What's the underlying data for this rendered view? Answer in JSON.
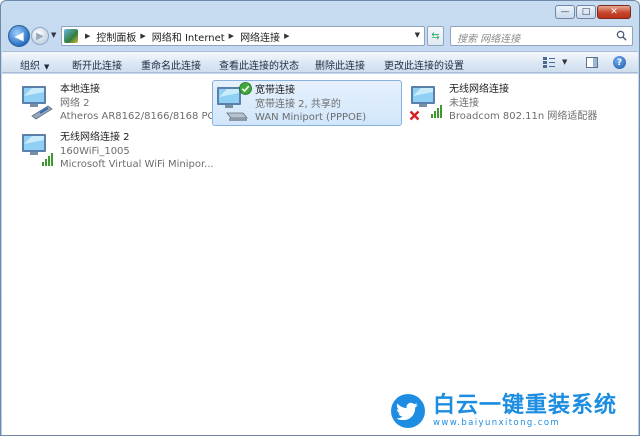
{
  "window": {
    "minimize_glyph": "—",
    "maximize_glyph": "□",
    "close_glyph": "✕"
  },
  "address": {
    "breadcrumbs": [
      "控制面板",
      "网络和 Internet",
      "网络连接"
    ],
    "search_placeholder": "搜索 网络连接"
  },
  "toolbar": {
    "organize": "组织",
    "disconnect": "断开此连接",
    "rename": "重命名此连接",
    "view_status": "查看此连接的状态",
    "delete": "删除此连接",
    "change_settings": "更改此连接的设置",
    "help_glyph": "?"
  },
  "connections": [
    {
      "name": "本地连接",
      "status": "网络  2",
      "device": "Atheros AR8162/8166/8168 PC...",
      "icon": "ethernet-icon"
    },
    {
      "name": "宽带连接",
      "status": "宽带连接  2, 共享的",
      "device": "WAN Miniport (PPPOE)",
      "icon": "broadband-icon",
      "badge": "connected-check",
      "selected": true
    },
    {
      "name": "无线网络连接",
      "status": "未连接",
      "device": "Broadcom 802.11n 网络适配器",
      "icon": "wireless-icon",
      "badge": "disconnected-x"
    },
    {
      "name": "无线网络连接 2",
      "status": "160WiFi_1005",
      "device": "Microsoft Virtual WiFi Minipor...",
      "icon": "wireless-icon"
    }
  ],
  "watermark": {
    "brand": "白云一键重装系统",
    "url": "www.baiyunxitong.com"
  },
  "colors": {
    "accent": "#1c8de0",
    "selection": "#d1e6fb",
    "toolbar": "#dde8f4",
    "close": "#c8452c"
  }
}
